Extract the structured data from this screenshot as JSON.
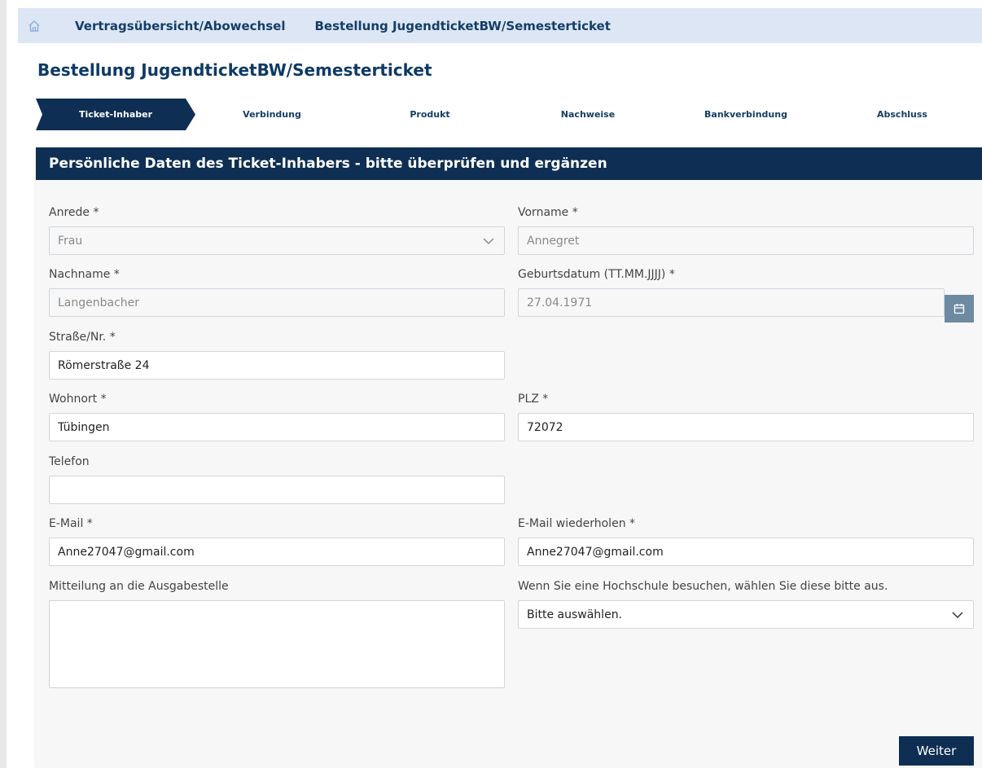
{
  "breadcrumb": {
    "items": [
      "Vertragsübersicht/Abowechsel",
      "Bestellung JugendticketBW/Semesterticket"
    ]
  },
  "page": {
    "title": "Bestellung JugendticketBW/Semesterticket"
  },
  "stepper": {
    "steps": [
      "Ticket-Inhaber",
      "Verbindung",
      "Produkt",
      "Nachweise",
      "Bankverbindung",
      "Abschluss"
    ],
    "active_index": 0
  },
  "form": {
    "heading": "Persönliche Daten des Ticket-Inhabers - bitte überprüfen und ergänzen",
    "anrede": {
      "label": "Anrede *",
      "value": "Frau"
    },
    "vorname": {
      "label": "Vorname *",
      "value": "Annegret"
    },
    "nachname": {
      "label": "Nachname *",
      "value": "Langenbacher"
    },
    "geburtsdatum": {
      "label": "Geburtsdatum (TT.MM.JJJJ) *",
      "value": "27.04.1971"
    },
    "strasse": {
      "label": "Straße/Nr. *",
      "value": "Römerstraße 24"
    },
    "wohnort": {
      "label": "Wohnort *",
      "value": "Tübingen"
    },
    "plz": {
      "label": "PLZ *",
      "value": "72072"
    },
    "telefon": {
      "label": "Telefon",
      "value": ""
    },
    "email": {
      "label": "E-Mail *",
      "value": "Anne27047@gmail.com"
    },
    "email_repeat": {
      "label": "E-Mail wiederholen *",
      "value": "Anne27047@gmail.com"
    },
    "mitteilung": {
      "label": "Mitteilung an die Ausgabestelle",
      "value": ""
    },
    "hochschule": {
      "label": "Wenn Sie eine Hochschule besuchen, wählen Sie diese bitte aus.",
      "value": "Bitte auswählen."
    }
  },
  "actions": {
    "next_label": "Weiter"
  },
  "colors": {
    "navy": "#0e2f53",
    "breadcrumb_bg": "#dce6f5",
    "calendar_button": "#6e8aa3"
  }
}
